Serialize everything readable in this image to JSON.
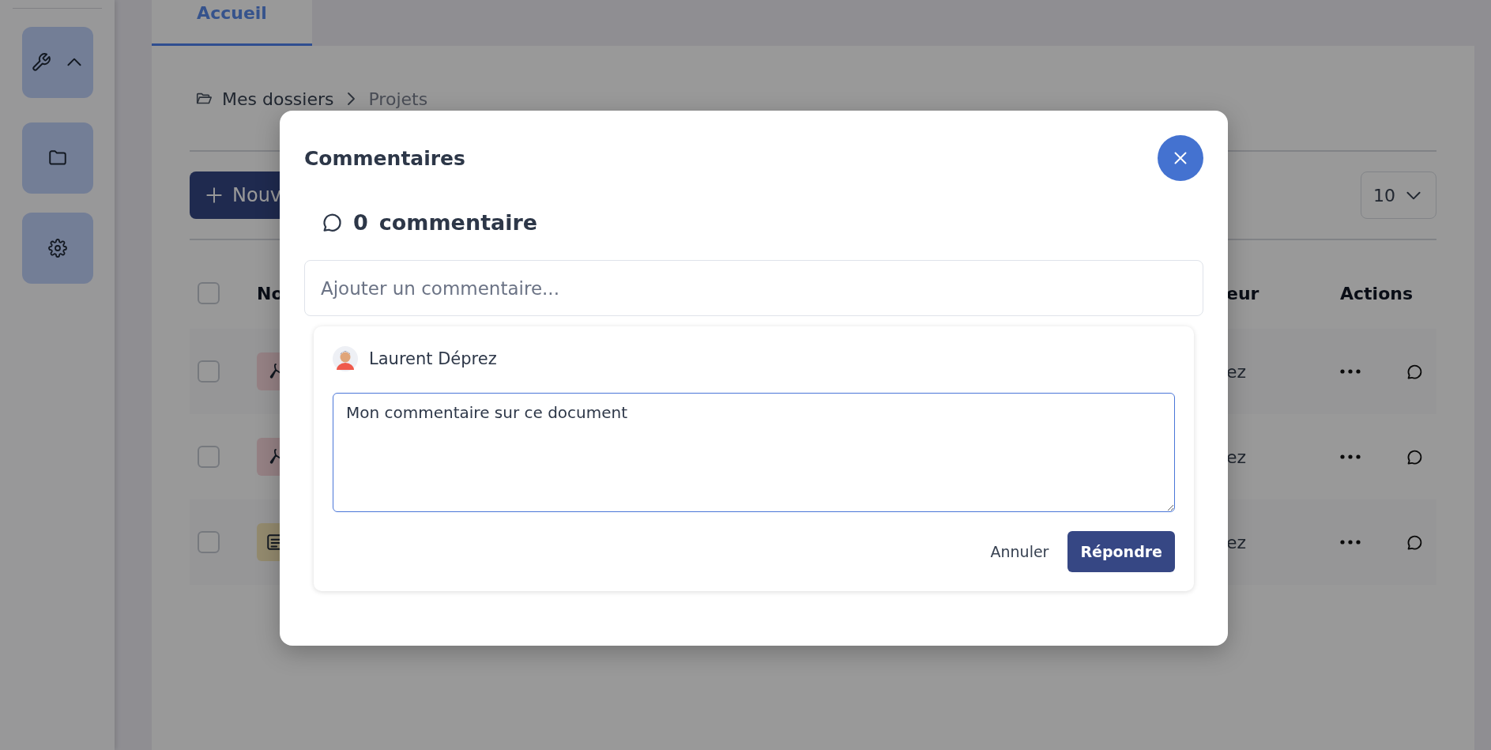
{
  "sidebar": {
    "tools_menu": {
      "expanded": true
    }
  },
  "tabs": [
    {
      "label": "Accueil",
      "selected": true
    }
  ],
  "breadcrumb": [
    "Mes dossiers",
    "Projets"
  ],
  "toolbar": {
    "new_button": "Nouv",
    "page_size": "10"
  },
  "table": {
    "header_checked": false,
    "columns": [
      "No",
      "eur",
      "Actions"
    ],
    "rows": [
      {
        "kind": "pdf",
        "checked": false,
        "column_2": "ez"
      },
      {
        "kind": "pdf",
        "checked": false,
        "column_2": "ez"
      },
      {
        "kind": "text",
        "checked": false,
        "column_2": "ez"
      }
    ]
  },
  "modal": {
    "title": "Commentaires",
    "count": "0",
    "count_label": "commentaire",
    "comment_field": {
      "placeholder": "Ajouter un commentaire..."
    },
    "reply": {
      "author": "Laurent Déprez",
      "value": "Mon commentaire sur ce document",
      "cancel": "Annuler",
      "submit": "Répondre"
    }
  }
}
